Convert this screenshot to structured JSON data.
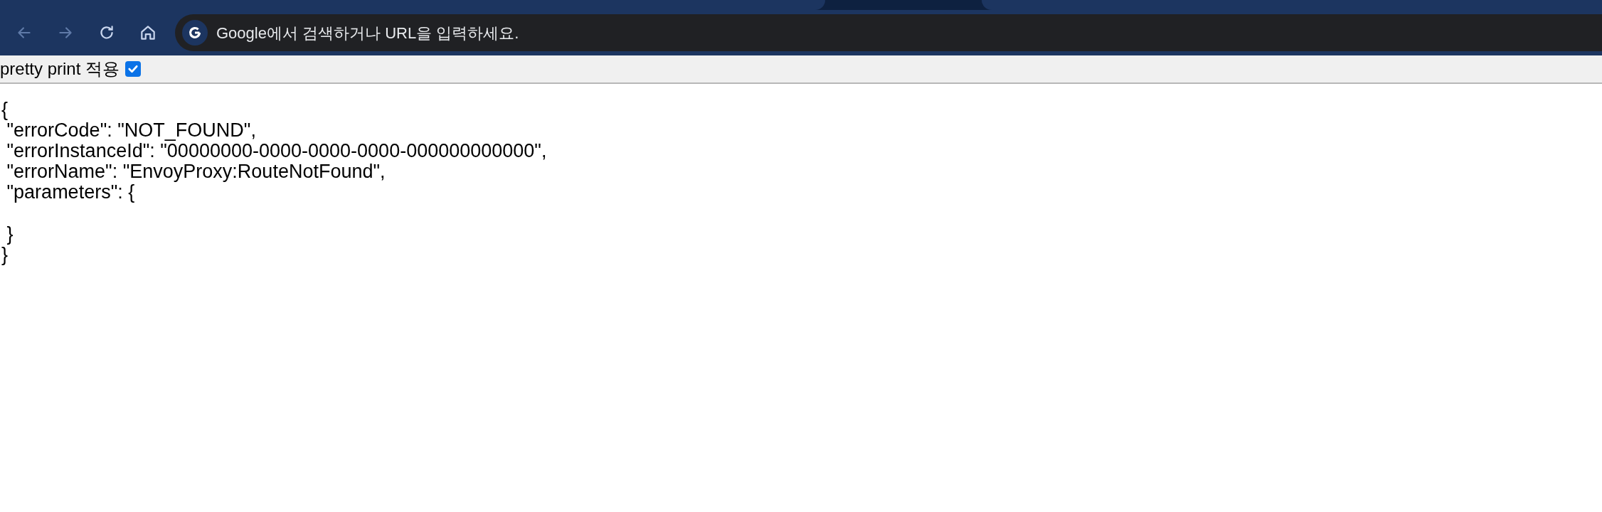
{
  "browser": {
    "address_bar": {
      "placeholder": "Google에서 검색하거나 URL을 입력하세요."
    },
    "back_disabled": true,
    "forward_disabled": true
  },
  "pretty_print": {
    "label": "pretty print 적용",
    "checked": true
  },
  "json_lines": [
    {
      "text": "{",
      "kind": "line"
    },
    {
      "text": " \"errorCode\": \"NOT_FOUND\",",
      "kind": "line"
    },
    {
      "text": " \"errorInstanceId\": \"00000000-0000-0000-0000-000000000000\",",
      "kind": "line"
    },
    {
      "text": " \"errorName\": \"EnvoyProxy:RouteNotFound\",",
      "kind": "line"
    },
    {
      "text": " \"parameters\": {",
      "kind": "line"
    },
    {
      "text": " }",
      "kind": "after_blank"
    },
    {
      "text": "}",
      "kind": "line"
    }
  ]
}
